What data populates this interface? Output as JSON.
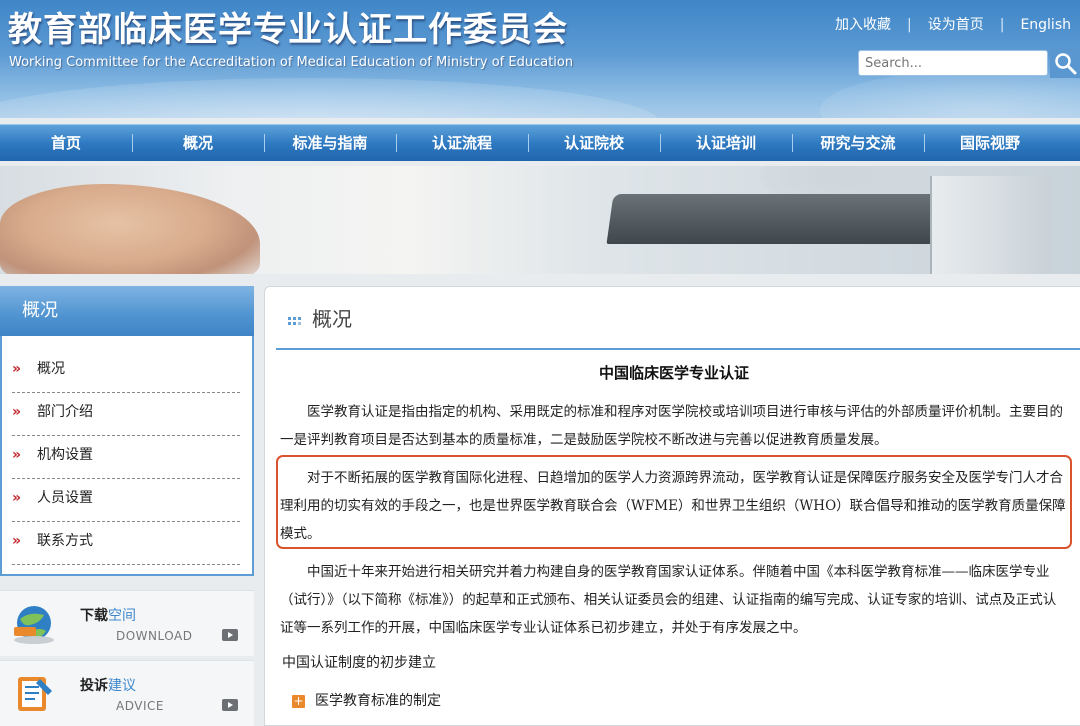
{
  "header": {
    "title": "教育部临床医学专业认证工作委员会",
    "subtitle": "Working Committee for the Accreditation of Medical Education of Ministry of Education",
    "links": [
      "加入收藏",
      "设为首页",
      "English"
    ],
    "separator": "|",
    "search_placeholder": "Search..."
  },
  "nav": {
    "items": [
      "首页",
      "概况",
      "标准与指南",
      "认证流程",
      "认证院校",
      "认证培训",
      "研究与交流",
      "国际视野"
    ]
  },
  "sidebar": {
    "title": "概况",
    "bullet": "»",
    "items": [
      "概况",
      "部门介绍",
      "机构设置",
      "人员设置",
      "联系方式"
    ],
    "widgets": [
      {
        "title_a": "下载",
        "title_b": "空间",
        "sub": "DOWNLOAD"
      },
      {
        "title_a": "投诉",
        "title_b": "建议",
        "sub": "ADVICE"
      }
    ]
  },
  "main": {
    "heading": "概况",
    "article_title": "中国临床医学专业认证",
    "paragraphs": [
      "医学教育认证是指由指定的机构、采用既定的标准和程序对医学院校或培训项目进行审核与评估的外部质量评价机制。主要目的一是评判教育项目是否达到基本的质量标准，二是鼓励医学院校不断改进与完善以促进教育质量发展。",
      "对于不断拓展的医学教育国际化进程、日趋增加的医学人力资源跨界流动，医学教育认证是保障医疗服务安全及医学专门人才合理利用的切实有效的手段之一，也是世界医学教育联合会（WFME）和世界卫生组织（WHO）联合倡导和推动的医学教育质量保障模式。",
      "中国近十年来开始进行相关研究并着力构建自身的医学教育国家认证体系。伴随着中国《本科医学教育标准——临床医学专业（试行）》（以下简称《标准》）的起草和正式颁布、相关认证委员会的组建、认证指南的编写完成、认证专家的培训、试点及正式认证等一系列工作的开展，中国临床医学专业认证体系已初步建立，并处于有序发展之中。"
    ],
    "section_title": "中国认证制度的初步建立",
    "sub_item_icon": "+",
    "sub_item": "医学教育标准的制定"
  }
}
